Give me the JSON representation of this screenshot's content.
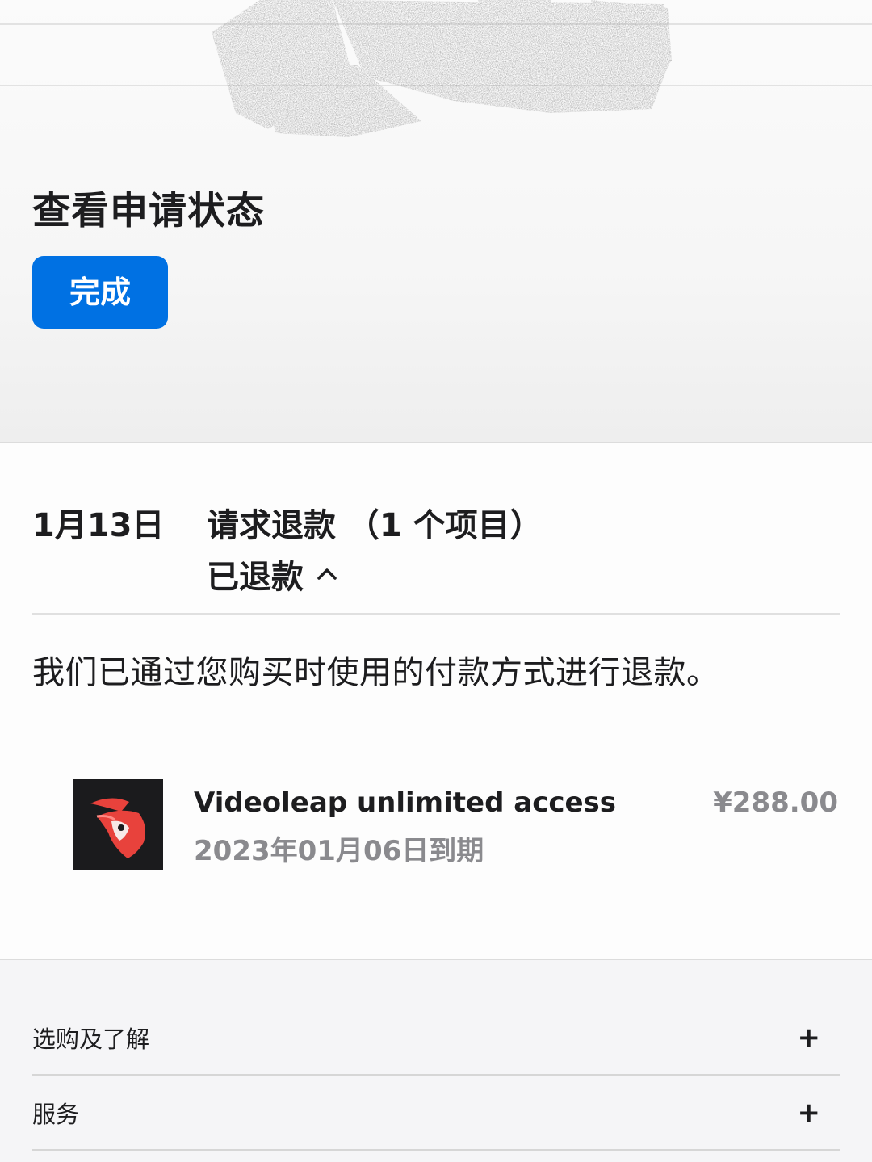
{
  "header": {
    "title": "查看申请状态",
    "done_label": "完成"
  },
  "request": {
    "date": "1月13日",
    "title": "请求退款 （1 个项目）",
    "status": "已退款",
    "note": "我们已通过您购买时使用的付款方式进行退款。"
  },
  "item": {
    "icon": "videoleap-app-icon",
    "name": "Videoleap unlimited access",
    "expiry": "2023年01月06日到期",
    "price": "¥288.00"
  },
  "footer": {
    "sections": [
      {
        "label": "选购及了解",
        "icon": "+"
      },
      {
        "label": "服务",
        "icon": "+"
      }
    ]
  },
  "colors": {
    "accent": "#0071e3",
    "secondary_text": "#8a8a8e",
    "app_icon_bg": "#1b1b1d",
    "app_icon_red": "#e8423c"
  }
}
